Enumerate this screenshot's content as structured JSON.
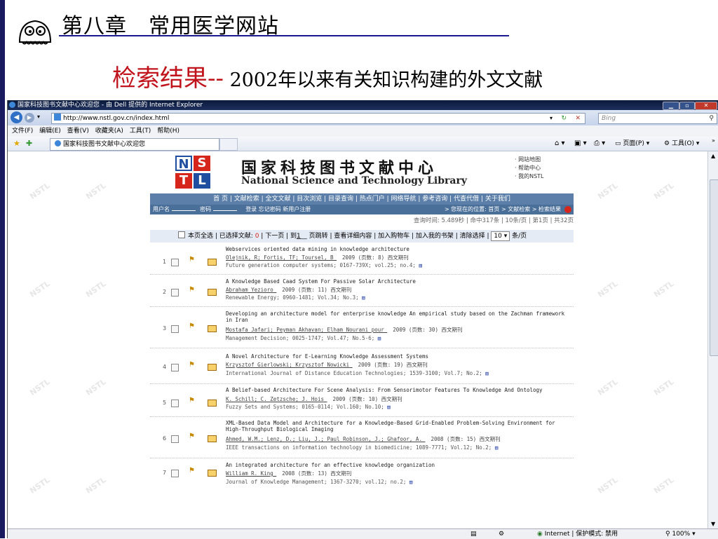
{
  "slide": {
    "chapter": "第八章　常用医学网站",
    "title_red": "检索结果--",
    "title_black": " 2002年以来有关知识构建的外文文献"
  },
  "browser": {
    "window_title": "国家科技图书文献中心欢迎您 - 由 Dell 提供的 Internet Explorer",
    "url": "http://www.nstl.gov.cn/index.html",
    "search_placeholder": "Bing",
    "menu": [
      "文件(F)",
      "编辑(E)",
      "查看(V)",
      "收藏夹(A)",
      "工具(T)",
      "帮助(H)"
    ],
    "tab_label": "国家科技图书文献中心欢迎您",
    "command_bar": [
      "页面(P)",
      "工具(O)"
    ],
    "status": {
      "zone": "Internet | 保护模式: 禁用",
      "zoom": "100%"
    }
  },
  "site": {
    "logo_letters": [
      "N",
      "S",
      "T",
      "L"
    ],
    "name_cn": "国家科技图书文献中心",
    "name_en": "National Science and Technology Library",
    "top_links": [
      "· 网站地图",
      "· 帮助中心",
      "· 我的NSTL"
    ],
    "nav": "首 页 | 文献检索 | 全文文献 | 目次浏览 | 目录查询 | 热点门户 | 网络导航 | 参考咨询 | 代查代借 | 关于我们",
    "login": {
      "user_label": "用户名",
      "pwd_label": "密码",
      "actions": "登录 忘记密码 新用户注册",
      "location": "> 您现在的位置: 首页 > 文献检索 > 检索结果"
    },
    "query_info": "查询时间: 5.489秒 | 命中317条 | 10条/页 | 第1页 | 共32页",
    "toolbar": {
      "select_all": "本页全选",
      "selected_label": "已选择文献:",
      "selected_count": "0",
      "next": "下一页",
      "goto_prefix": "到",
      "goto_value": "1",
      "goto_suffix": "页跳转",
      "actions": "查看详细内容 | 加入购物车 | 加入我的书架 | 清除选择 |",
      "per_page": "10",
      "per_page_suffix": "条/页"
    },
    "results": [
      {
        "n": "1",
        "title": "Webservices oriented data mining in knowledge architecture",
        "authors": "Olejnik, R; Fortis, TF; Toursel, B",
        "meta": "2009  (页数: 8) 西文期刊",
        "journal": "Future generation computer systems; 0167-739X; vol.25; no.4;"
      },
      {
        "n": "2",
        "title": "A Knowledge Based Caad System For Passive Solar Architecture",
        "authors": "Abraham Yezioro",
        "meta": "2009  (页数: 11) 西文期刊",
        "journal": "Renewable Energy; 0960-1481; Vol.34; No.3;"
      },
      {
        "n": "3",
        "title": "Developing an architecture model for enterprise knowledge An empirical study based on the Zachman framework in Iran",
        "authors": "Mostafa Jafari; Peyman Akhavan; Elham Nourani pour",
        "meta": "2009  (页数: 30) 西文期刊",
        "journal": "Management Decision; 0025-1747; Vol.47; No.5-6;"
      },
      {
        "n": "4",
        "title": "A Novel Architecture for E-Learning Knowledge Assessment Systems",
        "authors": "Krzysztof Gierlowski; Krzysztof Nowicki",
        "meta": "2009  (页数: 19) 西文期刊",
        "journal": "International Journal of Distance Education Technologies; 1539-3100; Vol.7; No.2;"
      },
      {
        "n": "5",
        "title": "A Belief-based Architecture For Scene Analysis: From Sensorimotor Features To Knowledge And Ontology",
        "authors": "K. Schill; C. Zetzsche; J. Hois",
        "meta": "2009  (页数: 10) 西文期刊",
        "journal": "Fuzzy Sets and Systems; 0165-0114; Vol.160; No.10;"
      },
      {
        "n": "6",
        "title": "XML-Based Data Model and Architecture for a Knowledge-Based Grid-Enabled Problem-Solving Environment for High-Throughput Biological Imaging",
        "authors": "Ahmed, W.M.; Lenz, D.; Liu, J.; Paul Robinson, J.; Ghafoor, A.",
        "meta": "2008  (页数: 15) 西文期刊",
        "journal": "IEEE transactions on information technology in biomedicine; 1089-7771; Vol.12; No.2;"
      },
      {
        "n": "7",
        "title": "An integrated architecture for an effective knowledge organization",
        "authors": "William R. King",
        "meta": "2008  (页数: 13) 西文期刊",
        "journal": "Journal of Knowledge Management; 1367-3270; vol.12; no.2;"
      }
    ]
  },
  "colors": {
    "slide_title_red": "#c0131b",
    "nav_blue": "#5b7fa8",
    "logo_red": "#d6261c",
    "logo_blue": "#1f4ea0"
  }
}
